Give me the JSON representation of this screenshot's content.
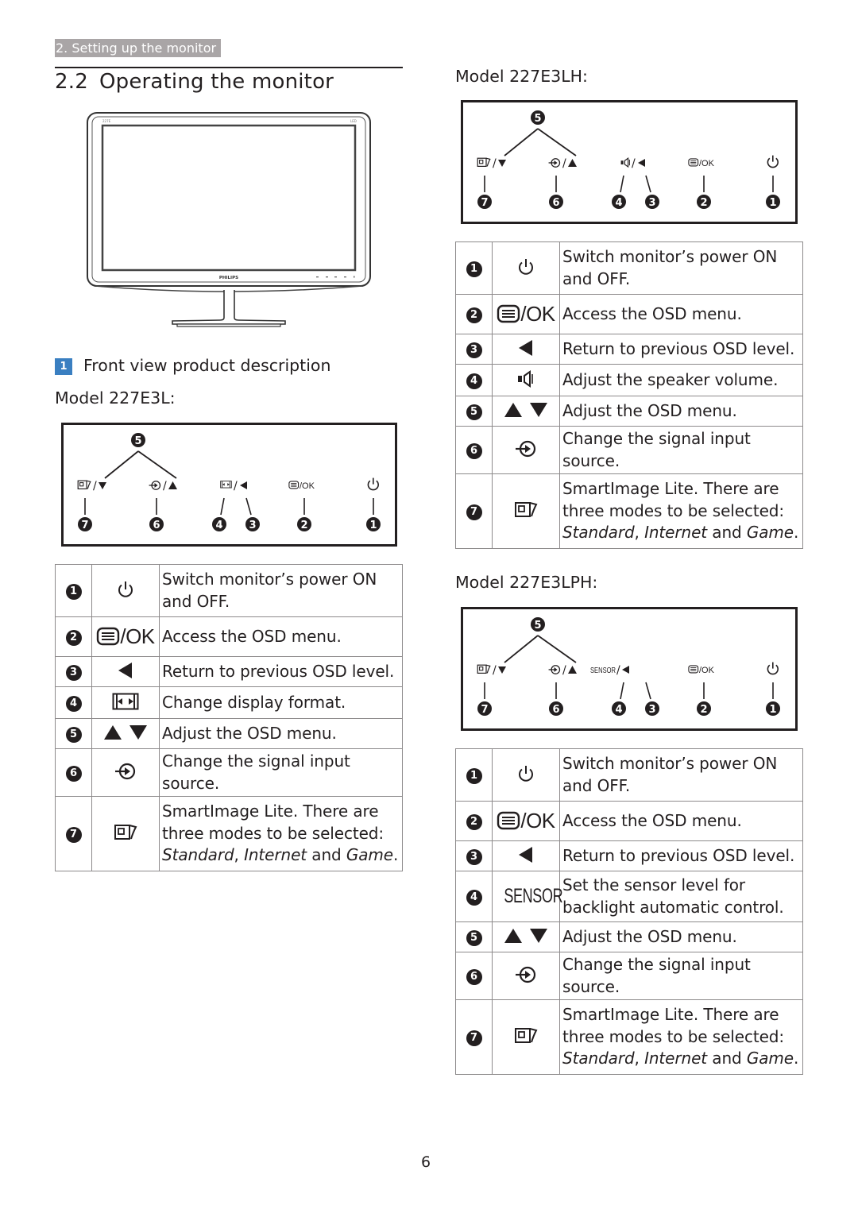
{
  "header": {
    "breadcrumb": "2. Setting up the monitor",
    "section_number": "2.2",
    "section_title": "Operating the monitor"
  },
  "illustration": {
    "brand": "PHILIPS",
    "model_mark": "227E",
    "led_mark": "LED"
  },
  "subsection": {
    "badge": "1",
    "title": "Front view product description"
  },
  "models": [
    {
      "label": "Model 227E3L:",
      "panel": {
        "button4_icon": "display-format-icon",
        "callouts": [
          "1",
          "2",
          "3",
          "4",
          "5",
          "6",
          "7"
        ],
        "ok_label": "/OK",
        "button4_label": ""
      },
      "rows": [
        {
          "num": "1",
          "icon": "power-icon",
          "desc": "Switch monitor’s power ON and OFF."
        },
        {
          "num": "2",
          "icon": "menu-ok-icon",
          "icon_text": "/OK",
          "desc": "Access the OSD menu."
        },
        {
          "num": "3",
          "icon": "left-arrow-icon",
          "desc": "Return to previous OSD level."
        },
        {
          "num": "4",
          "icon": "display-format-icon",
          "desc": "Change display format."
        },
        {
          "num": "5",
          "icon": "up-down-arrows-icon",
          "desc": "Adjust the OSD menu."
        },
        {
          "num": "6",
          "icon": "input-source-icon",
          "desc": "Change the signal input source."
        },
        {
          "num": "7",
          "icon": "smartimage-icon",
          "desc_plain": "SmartImage Lite. There are three modes to be selected: ",
          "mode1": "Standard",
          "sep1": ", ",
          "mode2": "Internet",
          "sep2": " and ",
          "mode3": "Game",
          "end": "."
        }
      ]
    },
    {
      "label": "Model 227E3LH:",
      "panel": {
        "button4_icon": "speaker-icon",
        "callouts": [
          "1",
          "2",
          "3",
          "4",
          "5",
          "6",
          "7"
        ],
        "ok_label": "/OK",
        "button4_label": ""
      },
      "rows": [
        {
          "num": "1",
          "icon": "power-icon",
          "desc": "Switch monitor’s power ON and OFF."
        },
        {
          "num": "2",
          "icon": "menu-ok-icon",
          "icon_text": "/OK",
          "desc": "Access the OSD menu."
        },
        {
          "num": "3",
          "icon": "left-arrow-icon",
          "desc": "Return to previous OSD level."
        },
        {
          "num": "4",
          "icon": "speaker-icon",
          "desc": "Adjust the speaker volume."
        },
        {
          "num": "5",
          "icon": "up-down-arrows-icon",
          "desc": "Adjust the OSD menu."
        },
        {
          "num": "6",
          "icon": "input-source-icon",
          "desc": "Change the signal input source."
        },
        {
          "num": "7",
          "icon": "smartimage-icon",
          "desc_plain": "SmartImage Lite. There are three modes to be selected: ",
          "mode1": "Standard",
          "sep1": ", ",
          "mode2": "Internet",
          "sep2": " and ",
          "mode3": "Game",
          "end": "."
        }
      ]
    },
    {
      "label": "Model 227E3LPH:",
      "panel": {
        "button4_icon": "sensor-label",
        "callouts": [
          "1",
          "2",
          "3",
          "4",
          "5",
          "6",
          "7"
        ],
        "ok_label": "/OK",
        "button4_label": "SENSOR"
      },
      "rows": [
        {
          "num": "1",
          "icon": "power-icon",
          "desc": "Switch monitor’s power ON and OFF."
        },
        {
          "num": "2",
          "icon": "menu-ok-icon",
          "icon_text": "/OK",
          "desc": "Access the OSD menu."
        },
        {
          "num": "3",
          "icon": "left-arrow-icon",
          "desc": "Return to previous OSD level."
        },
        {
          "num": "4",
          "icon": "sensor-label",
          "icon_text": "SENSOR",
          "desc": "Set the sensor level for backlight automatic control."
        },
        {
          "num": "5",
          "icon": "up-down-arrows-icon",
          "desc": "Adjust the OSD menu."
        },
        {
          "num": "6",
          "icon": "input-source-icon",
          "desc": "Change the signal input source."
        },
        {
          "num": "7",
          "icon": "smartimage-icon",
          "desc_plain": "SmartImage Lite. There are three modes to be selected: ",
          "mode1": "Standard",
          "sep1": ", ",
          "mode2": "Internet",
          "sep2": " and ",
          "mode3": "Game",
          "end": "."
        }
      ]
    }
  ],
  "footer": {
    "page_number": "6"
  }
}
